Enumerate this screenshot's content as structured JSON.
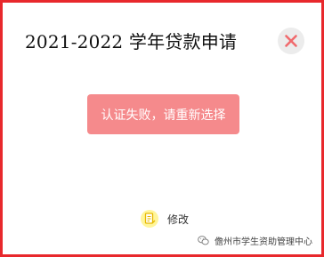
{
  "dialog": {
    "title": "2021-2022 学年贷款申请",
    "close_icon": "close-icon",
    "error_message": "认证失败，请重新选择",
    "edit_label": "修改",
    "edit_icon": "edit-document-icon"
  },
  "watermark": {
    "text": "儋州市学生资助管理中心",
    "icon": "wechat-icon"
  },
  "colors": {
    "border": "#e8282c",
    "error_bg": "#f58a8c",
    "close_x": "#f06a6d",
    "edit_icon_circle": "#fff59a",
    "edit_icon_doc": "#e6b800"
  }
}
